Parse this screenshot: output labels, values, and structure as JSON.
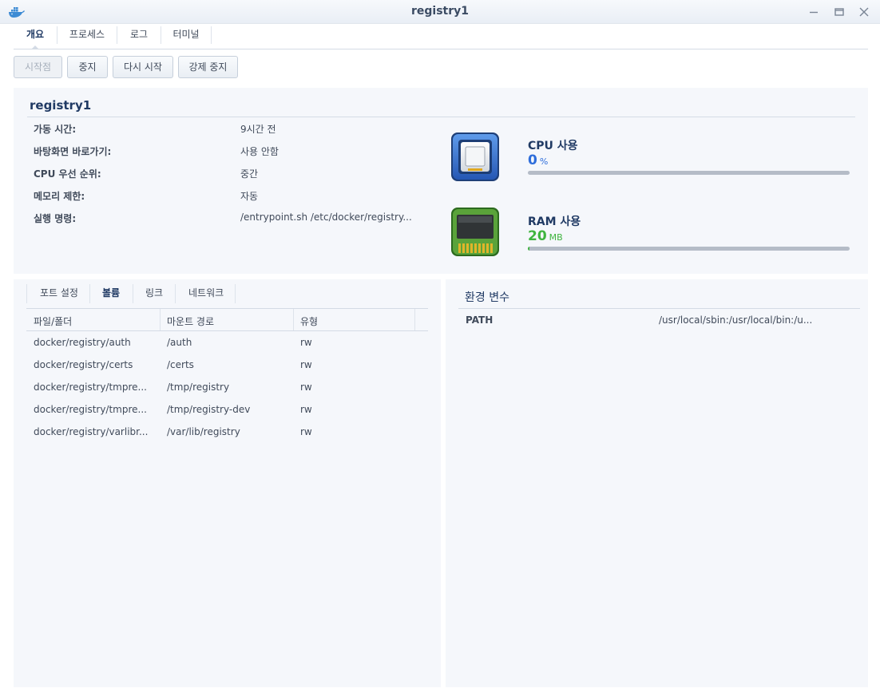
{
  "window": {
    "title": "registry1",
    "app_icon": "docker-whale-icon",
    "controls": [
      "minimize-icon",
      "maximize-icon",
      "close-icon"
    ]
  },
  "tabs": [
    {
      "label": "개요",
      "active": true
    },
    {
      "label": "프로세스",
      "active": false
    },
    {
      "label": "로그",
      "active": false
    },
    {
      "label": "터미널",
      "active": false
    }
  ],
  "toolbar": {
    "start_label": "시작점",
    "stop_label": "중지",
    "restart_label": "다시 시작",
    "force_stop_label": "강제 중지"
  },
  "overview": {
    "container_name": "registry1",
    "fields": [
      {
        "label": "가동 시간:",
        "value": "9시간 전"
      },
      {
        "label": "바탕화면 바로가기:",
        "value": "사용 안함"
      },
      {
        "label": "CPU 우선 순위:",
        "value": "중간"
      },
      {
        "label": "메모리 제한:",
        "value": "자동"
      },
      {
        "label": "실행 명령:",
        "value": "/entrypoint.sh /etc/docker/registry..."
      }
    ],
    "cpu": {
      "title": "CPU 사용",
      "value": "0",
      "unit": "%",
      "fraction": 0.0,
      "color": "#2e6ddb",
      "icon": "cpu-chip-icon"
    },
    "ram": {
      "title": "RAM 사용",
      "value": "20",
      "unit": "MB",
      "fraction": 0.003,
      "color": "#3fb43f",
      "icon": "ram-module-icon"
    }
  },
  "volume": {
    "tabs": [
      {
        "label": "포트 설정",
        "active": false
      },
      {
        "label": "볼륨",
        "active": true
      },
      {
        "label": "링크",
        "active": false
      },
      {
        "label": "네트워크",
        "active": false
      }
    ],
    "columns": [
      "파일/폴더",
      "마운트 경로",
      "유형"
    ],
    "rows": [
      [
        "docker/registry/auth",
        "/auth",
        "rw"
      ],
      [
        "docker/registry/certs",
        "/certs",
        "rw"
      ],
      [
        "docker/registry/tmpre...",
        "/tmp/registry",
        "rw"
      ],
      [
        "docker/registry/tmpre...",
        "/tmp/registry-dev",
        "rw"
      ],
      [
        "docker/registry/varlibr...",
        "/var/lib/registry",
        "rw"
      ]
    ]
  },
  "env": {
    "title": "환경 변수",
    "vars": [
      {
        "key": "PATH",
        "value": "/usr/local/sbin:/usr/local/bin:/u..."
      }
    ]
  }
}
